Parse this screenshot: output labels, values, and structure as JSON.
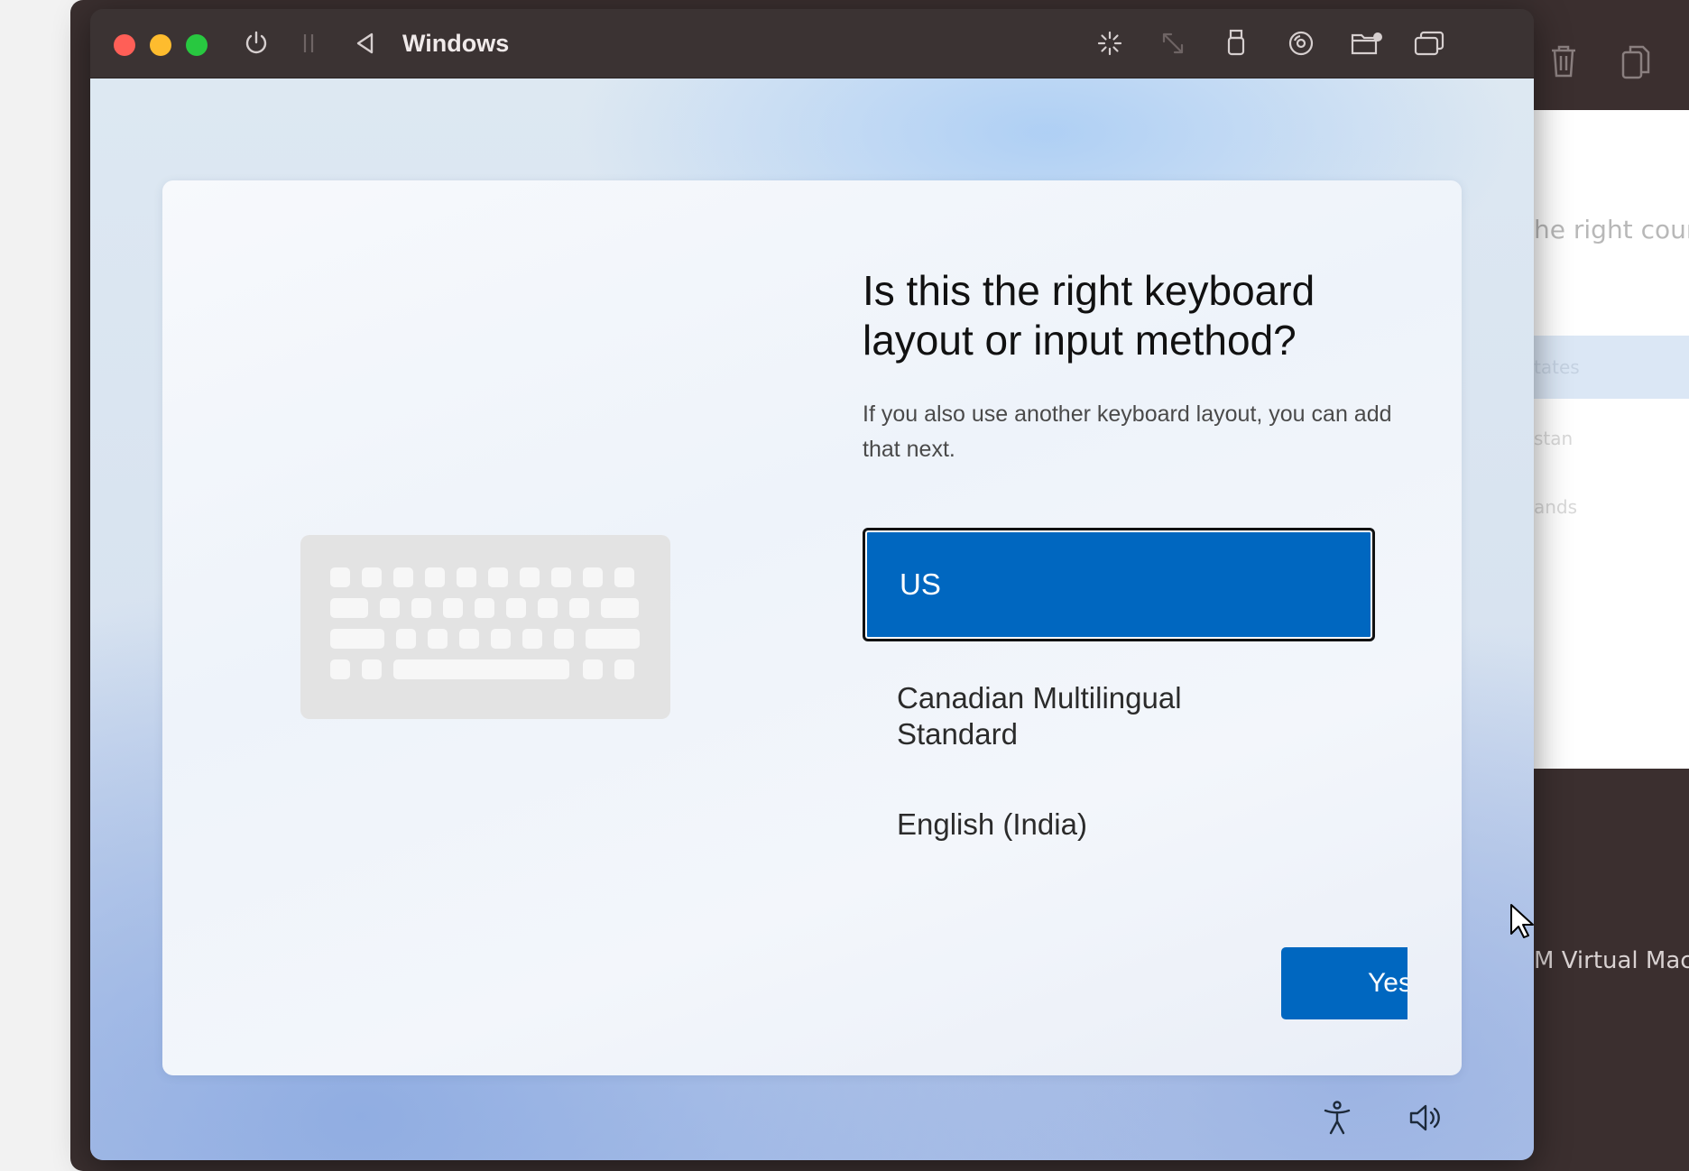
{
  "app": {
    "window_title": "Windows"
  },
  "titlebar_icons": [
    "power-icon",
    "pause-icon",
    "back-icon",
    "loading-icon",
    "resize-icon",
    "usb-icon",
    "disc-icon",
    "shared-folder-icon",
    "windows-icon"
  ],
  "background_window": {
    "panel_title": "he right count",
    "selected_item": "tates",
    "faint_items": [
      "stan",
      "ands"
    ],
    "bottom_text": "M Virtual Mach",
    "toolbar_icons": [
      "trash-icon",
      "copy-icon"
    ]
  },
  "oobe": {
    "heading": "Is this the right keyboard layout or input method?",
    "subtext": "If you also use another keyboard layout, you can add that next.",
    "options": [
      {
        "label": "US",
        "selected": true
      },
      {
        "label": "Canadian Multilingual Standard",
        "selected": false
      },
      {
        "label": "English (India)",
        "selected": false
      }
    ],
    "yes_label": "Yes"
  },
  "footer_icons": [
    "accessibility-icon",
    "volume-icon"
  ],
  "colors": {
    "accent": "#0067c0",
    "titlebar": "#3b3333",
    "close": "#ff5f57",
    "minimize": "#febc2e",
    "zoom": "#28c840"
  }
}
